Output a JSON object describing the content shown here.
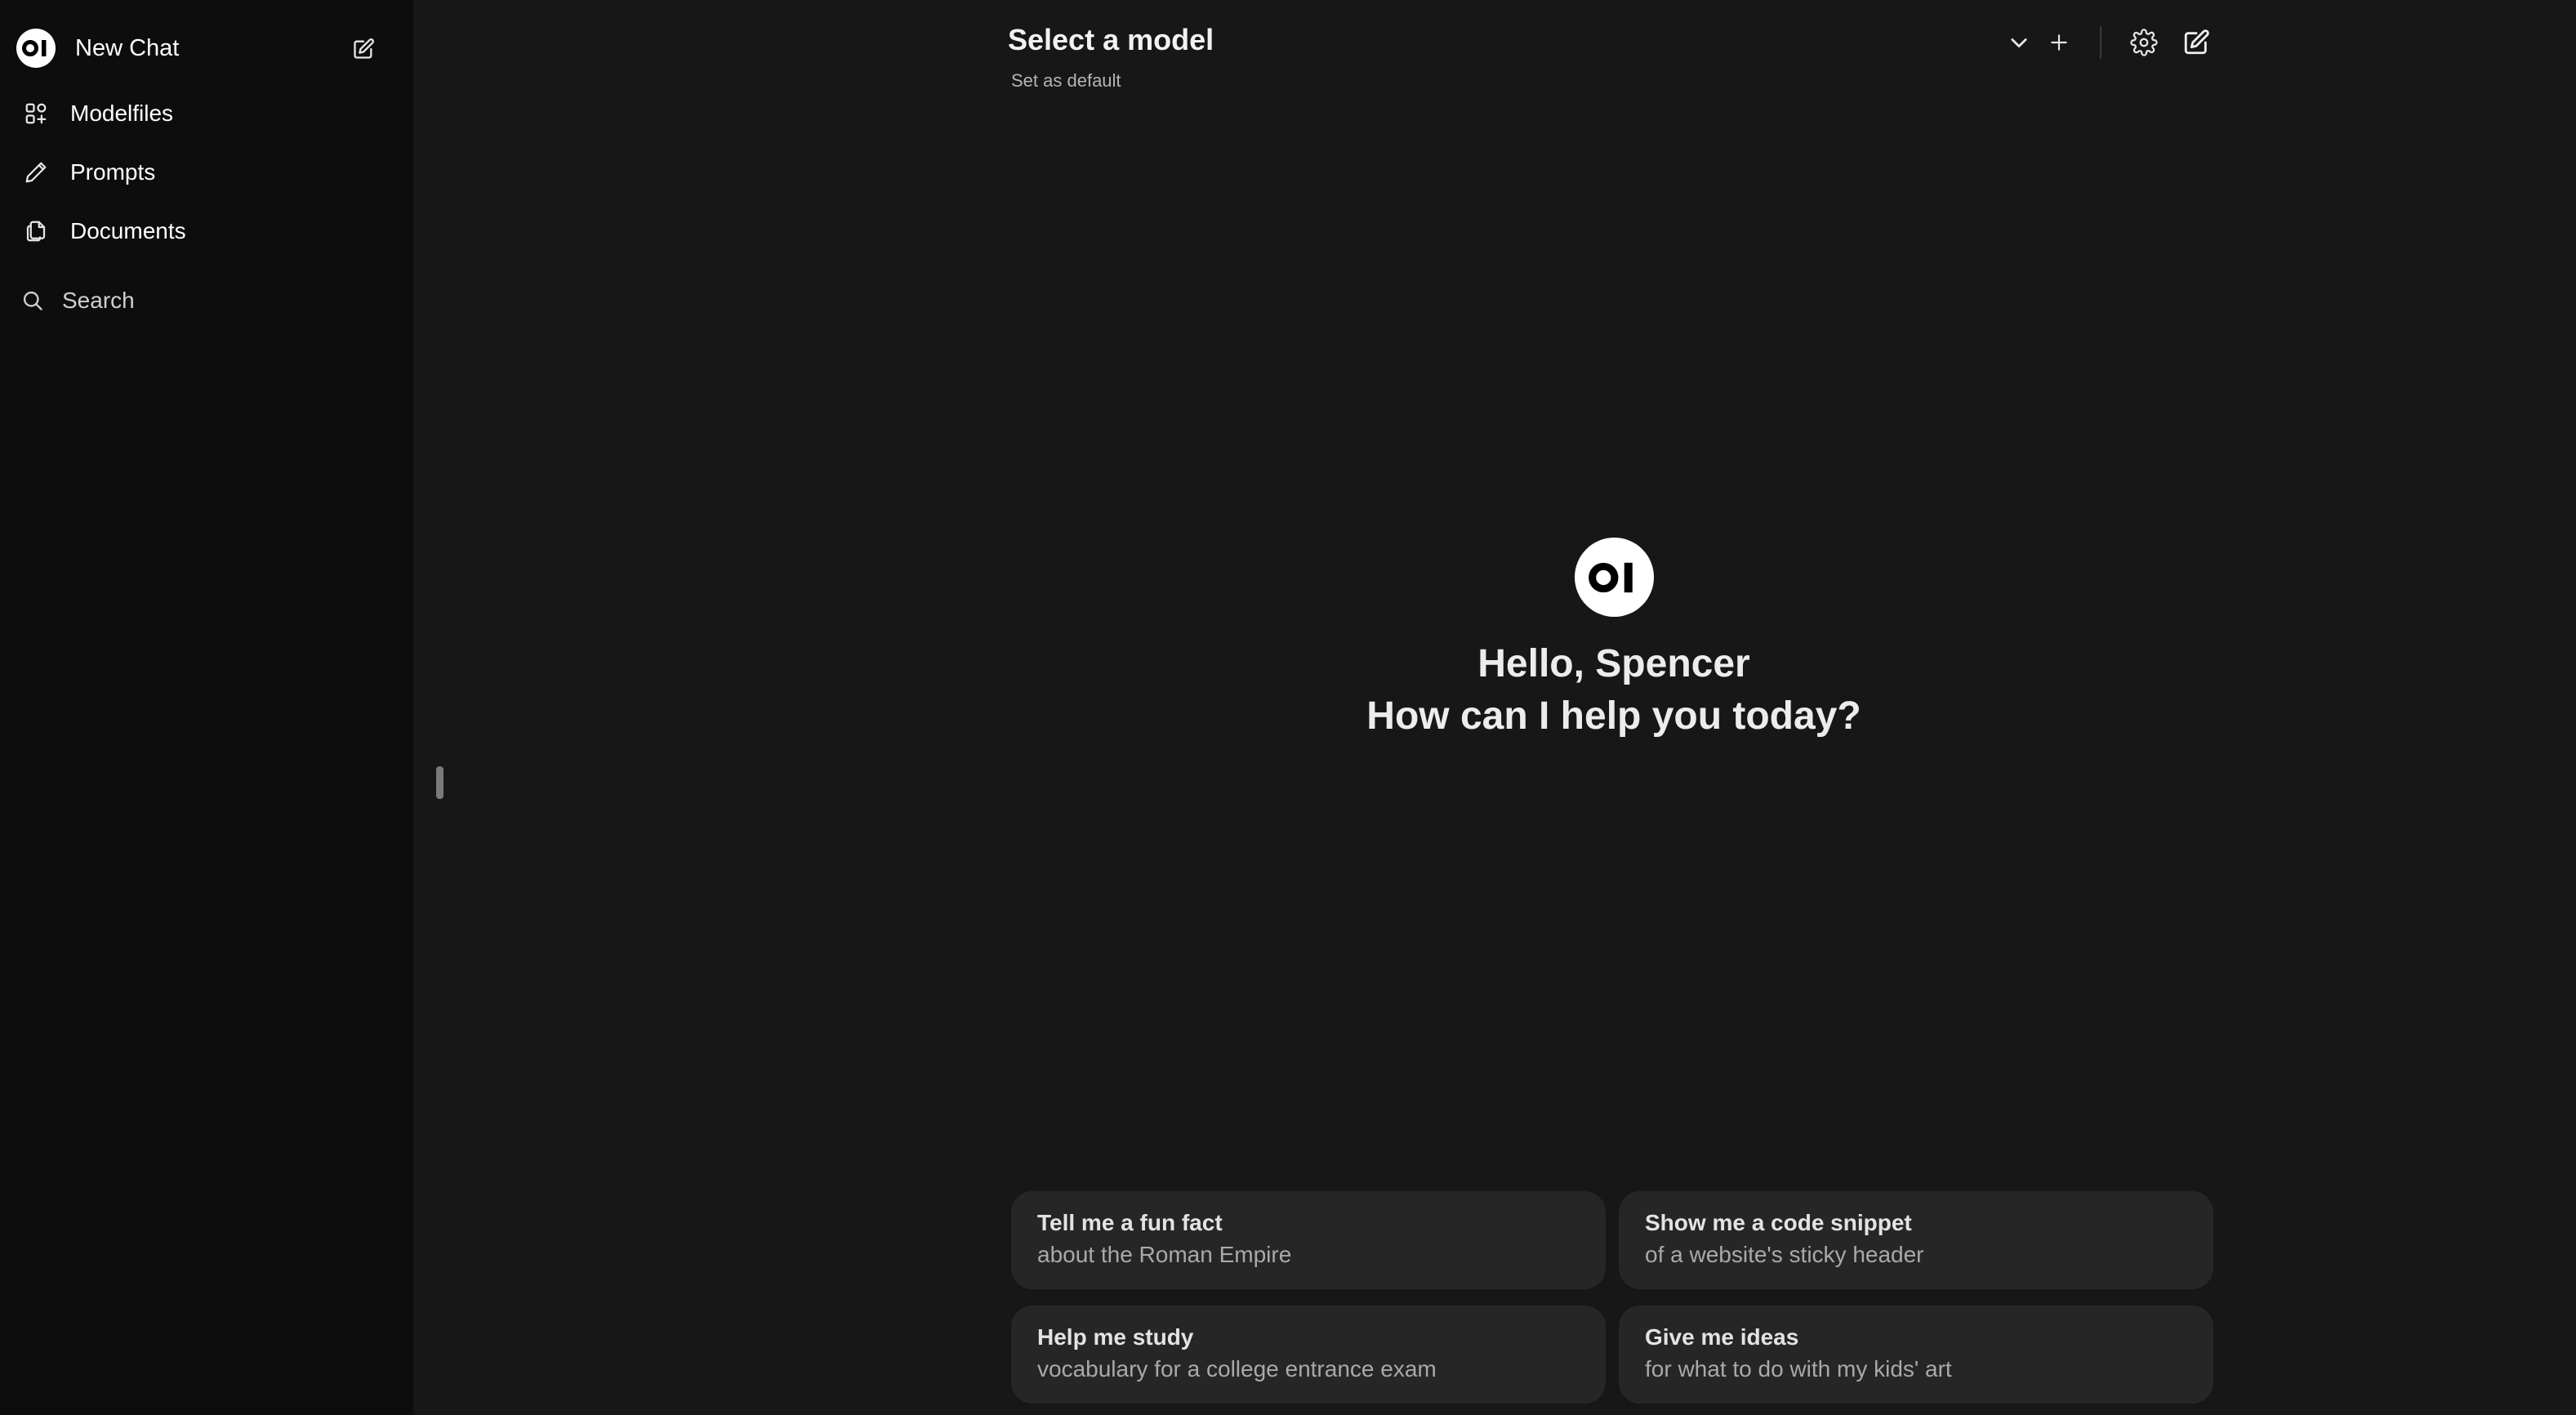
{
  "sidebar": {
    "new_chat_label": "New Chat",
    "logo_text": "OI",
    "items": [
      {
        "label": "Modelfiles",
        "icon": "modelfiles-icon"
      },
      {
        "label": "Prompts",
        "icon": "pencil-icon"
      },
      {
        "label": "Documents",
        "icon": "documents-icon"
      }
    ],
    "search_placeholder": "Search"
  },
  "header": {
    "model_select_label": "Select a model",
    "set_default_label": "Set as default"
  },
  "hero": {
    "logo_text": "OI",
    "greeting": "Hello, Spencer",
    "subtitle": "How can I help you today?"
  },
  "suggestions": [
    {
      "title": "Tell me a fun fact",
      "detail": "about the Roman Empire"
    },
    {
      "title": "Show me a code snippet",
      "detail": "of a website's sticky header"
    },
    {
      "title": "Help me study",
      "detail": "vocabulary for a college entrance exam"
    },
    {
      "title": "Give me ideas",
      "detail": "for what to do with my kids' art"
    }
  ],
  "colors": {
    "sidebar_bg": "#0d0d0d",
    "main_bg": "#171717",
    "card_bg": "#262626",
    "text": "#ececec"
  }
}
